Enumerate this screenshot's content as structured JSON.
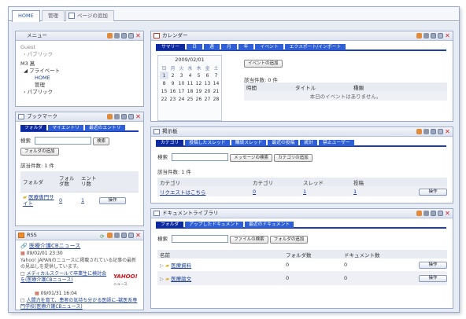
{
  "tabs": [
    {
      "label": "HOME"
    },
    {
      "label": "管理"
    },
    {
      "label": "ページの追加"
    }
  ],
  "menu": {
    "title": "メニュー",
    "guest": "Guest",
    "public1": "パブリック",
    "user": "M3 菖",
    "private": "プライベート",
    "home": "HOME",
    "kanri": "管理",
    "public2": "パブリック"
  },
  "bookmark": {
    "title": "ブックマーク",
    "tabs": [
      "フォルダ",
      "マイエントリ",
      "最近のエントリ"
    ],
    "search_label": "検索",
    "search_btn": "検索",
    "add_btn": "フォルダの追加",
    "count": "該当件数: 1 件",
    "cols": [
      "フォルダ",
      "フォルダ数",
      "エントリ数"
    ],
    "row": {
      "name": "医療専門サイト",
      "folders": "0",
      "entries": "1",
      "op": "操作"
    }
  },
  "rss": {
    "title": "RSS",
    "feed": "医療介護CBニュース",
    "date1": "09/02/01 23:30",
    "text1": "Yahoo! JAPANのニュースに掲載されている記事の最新の見出しを提供しています。",
    "item1": "メディカルスクールで卒業生に検討会を(医療介護CBニュース)",
    "date2": "09/01/31 16:04",
    "item2": "人間力を育て、患者の気持ち分かる医師に–獣医系専門学校(医療介護CBニュース)",
    "logo": "YAHOO!",
    "logo_sub": "ニュース"
  },
  "calendar": {
    "title": "カレンダー",
    "tabs": [
      "サマリー",
      "日",
      "週",
      "月",
      "年",
      "イベント",
      "エクスポート/インポート"
    ],
    "month": "2009/02/01",
    "weekdays": [
      "日",
      "月",
      "火",
      "水",
      "木",
      "金",
      "土"
    ],
    "weeks": [
      [
        "1",
        "2",
        "3",
        "4",
        "5",
        "6",
        "7"
      ],
      [
        "8",
        "9",
        "10",
        "11",
        "12",
        "13",
        "14"
      ],
      [
        "15",
        "16",
        "17",
        "18",
        "19",
        "20",
        "21"
      ],
      [
        "22",
        "23",
        "24",
        "25",
        "26",
        "27",
        "28"
      ]
    ],
    "add_btn": "イベントの追加",
    "count": "該当件数: 0 件",
    "cols": [
      "時間",
      "タイトル",
      "種類"
    ],
    "empty": "本日のイベントはありません。"
  },
  "board": {
    "title": "掲示板",
    "tabs": [
      "カテゴリ",
      "投稿したスレッド",
      "購読スレッド",
      "最近の投稿",
      "統計",
      "禁止ユーザー"
    ],
    "search_label": "検索",
    "search_btn": "メッセージの検索",
    "add_btn": "カテゴリの追加",
    "count": "該当件数: 1 件",
    "cols": [
      "カテゴリ",
      "カテゴリ",
      "スレッド",
      "投稿"
    ],
    "row": {
      "name": "リクエストはこちら",
      "cat": "0",
      "threads": "1",
      "posts": "1",
      "op": "操作"
    }
  },
  "doclib": {
    "title": "ドキュメントライブラリ",
    "tabs": [
      "フォルダ",
      "アップしたドキュメント",
      "最近のドキュメント"
    ],
    "search_label": "検索",
    "search_btn": "ファイルの検索",
    "add_btn": "フォルダの追加",
    "cols": [
      "名前",
      "フォルダ数",
      "ドキュメント数"
    ],
    "rows": [
      {
        "name": "医療資料",
        "folders": "0",
        "docs": "0",
        "op": "操作"
      },
      {
        "name": "医療論文",
        "folders": "0",
        "docs": "0",
        "op": "操作"
      }
    ]
  },
  "colors": {
    "accent": "#2f5fd6",
    "tab_active": "#0e2aa0",
    "frame": "#9cacc8",
    "close": "#d42222"
  }
}
